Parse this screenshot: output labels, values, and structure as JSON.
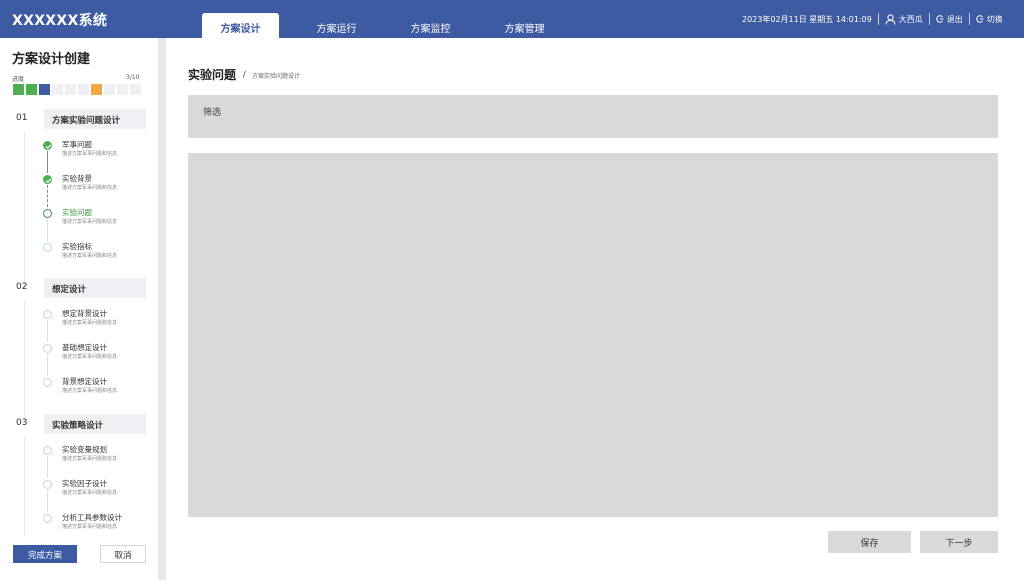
{
  "header": {
    "title": "XXXXXX系统",
    "tabs": [
      {
        "label": "方案设计",
        "active": true
      },
      {
        "label": "方案运行",
        "active": false
      },
      {
        "label": "方案监控",
        "active": false
      },
      {
        "label": "方案管理",
        "active": false
      }
    ],
    "datetime": "2023年02月11日 星期五 14:01:09",
    "user": "大西瓜",
    "logout": "退出",
    "switch": "切换",
    "icons": {
      "user": "user-icon",
      "logout": "logout-icon",
      "switch": "switch-icon"
    }
  },
  "sidebar": {
    "title": "方案设计创建",
    "progress_label": "进度",
    "progress_count": "3/10",
    "progress_cells": [
      "#4caf50",
      "#4caf50",
      "#3d5aa3",
      "#eef0f4",
      "#eef0f4",
      "#eef0f4",
      "#f5a742",
      "#eef0f4",
      "#eef0f4",
      "#eef0f4"
    ],
    "groups": [
      {
        "num": "01",
        "title": "方案实验问题设计",
        "steps": [
          {
            "title": "军事问题",
            "desc": "描述方案军事问题和信息",
            "state": "done"
          },
          {
            "title": "实验背景",
            "desc": "描述方案军事问题和信息",
            "state": "done"
          },
          {
            "title": "实验问题",
            "desc": "描述方案军事问题和信息",
            "state": "current"
          },
          {
            "title": "实验指标",
            "desc": "描述方案军事问题和信息",
            "state": "todo"
          }
        ]
      },
      {
        "num": "02",
        "title": "想定设计",
        "steps": [
          {
            "title": "想定背景设计",
            "desc": "描述方案军事问题和信息",
            "state": "todo"
          },
          {
            "title": "基础想定设计",
            "desc": "描述方案军事问题和信息",
            "state": "todo"
          },
          {
            "title": "背景想定设计",
            "desc": "描述方案军事问题和信息",
            "state": "todo"
          }
        ]
      },
      {
        "num": "03",
        "title": "实验策略设计",
        "steps": [
          {
            "title": "实验变量规划",
            "desc": "描述方案军事问题和信息",
            "state": "todo"
          },
          {
            "title": "实验因子设计",
            "desc": "描述方案军事问题和信息",
            "state": "todo"
          },
          {
            "title": "分析工具参数设计",
            "desc": "描述方案军事问题和信息",
            "state": "todo"
          }
        ]
      }
    ],
    "finish_label": "完成方案",
    "cancel_label": "取消"
  },
  "main": {
    "page_title": "实验问题",
    "crumb_sep": "/",
    "breadcrumb": "方案实验问题设计",
    "filter_label": "筛选",
    "save_label": "保存",
    "next_label": "下一步"
  },
  "colors": {
    "header_bg": "#3d5aa3",
    "done_green": "#4caf50",
    "current_green": "#3a8f3d",
    "panel_gray": "#d9d9d9",
    "progress_orange": "#f5a742"
  }
}
